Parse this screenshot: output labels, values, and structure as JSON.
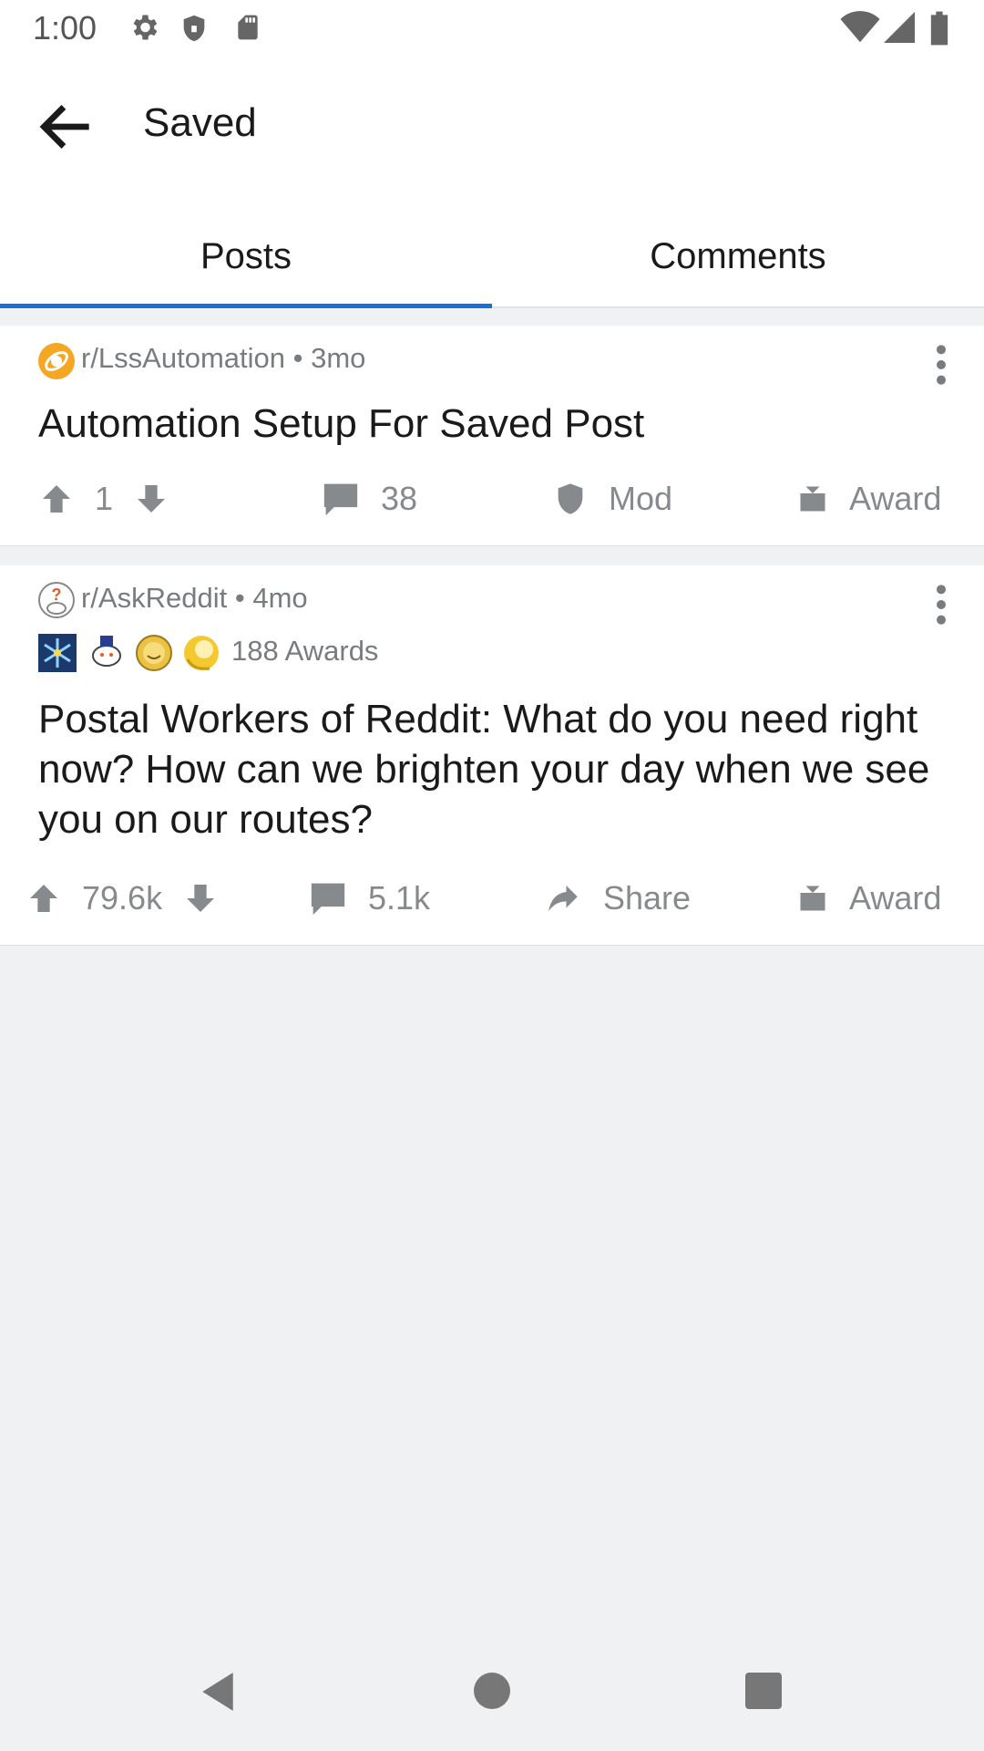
{
  "status_bar": {
    "time": "1:00",
    "icons": [
      "gear-icon",
      "shield-icon",
      "sd-card-icon",
      "wifi-icon",
      "signal-icon",
      "battery-icon"
    ]
  },
  "app_bar": {
    "title": "Saved",
    "back_icon": "arrow-back-icon"
  },
  "tabs": [
    {
      "label": "Posts",
      "active": true
    },
    {
      "label": "Comments",
      "active": false
    }
  ],
  "posts": [
    {
      "subreddit": "r/LssAutomation",
      "age": "3mo",
      "separator": "•",
      "title": "Automation Setup For Saved Post",
      "votes": "1",
      "comments": "38",
      "action3": "Mod",
      "action4": "Award"
    },
    {
      "subreddit": "r/AskReddit",
      "age": "4mo",
      "separator": "•",
      "awards": "188 Awards",
      "title": "Postal Workers of Reddit: What do you need right now? How can we brighten your day when we see you on our routes?",
      "votes": "79.6k",
      "comments": "5.1k",
      "action3": "Share",
      "action4": "Award"
    }
  ],
  "colors": {
    "accent": "#1a6fd6",
    "icon_gray": "#878a8c",
    "background": "#f0f1f3"
  }
}
